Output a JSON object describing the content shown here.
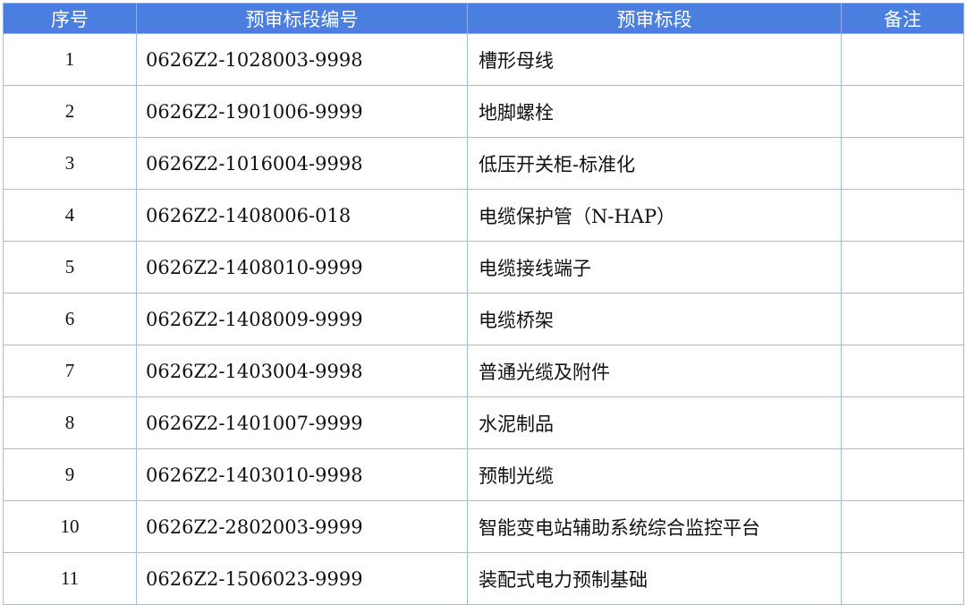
{
  "columns": {
    "index": "序号",
    "code": "预审标段编号",
    "name": "预审标段",
    "note": "备注"
  },
  "rows": [
    {
      "index": "1",
      "code": "0626Z2-1028003-9998",
      "name": "槽形母线",
      "note": ""
    },
    {
      "index": "2",
      "code": "0626Z2-1901006-9999",
      "name": "地脚螺栓",
      "note": ""
    },
    {
      "index": "3",
      "code": "0626Z2-1016004-9998",
      "name": "低压开关柜-标准化",
      "note": ""
    },
    {
      "index": "4",
      "code": "0626Z2-1408006-018",
      "name": "电缆保护管（N-HAP）",
      "note": ""
    },
    {
      "index": "5",
      "code": "0626Z2-1408010-9999",
      "name": "电缆接线端子",
      "note": ""
    },
    {
      "index": "6",
      "code": "0626Z2-1408009-9999",
      "name": "电缆桥架",
      "note": ""
    },
    {
      "index": "7",
      "code": "0626Z2-1403004-9998",
      "name": "普通光缆及附件",
      "note": ""
    },
    {
      "index": "8",
      "code": "0626Z2-1401007-9999",
      "name": "水泥制品",
      "note": ""
    },
    {
      "index": "9",
      "code": "0626Z2-1403010-9998",
      "name": "预制光缆",
      "note": ""
    },
    {
      "index": "10",
      "code": "0626Z2-2802003-9999",
      "name": "智能变电站辅助系统综合监控平台",
      "note": ""
    },
    {
      "index": "11",
      "code": "0626Z2-1506023-9999",
      "name": "装配式电力预制基础",
      "note": ""
    }
  ]
}
